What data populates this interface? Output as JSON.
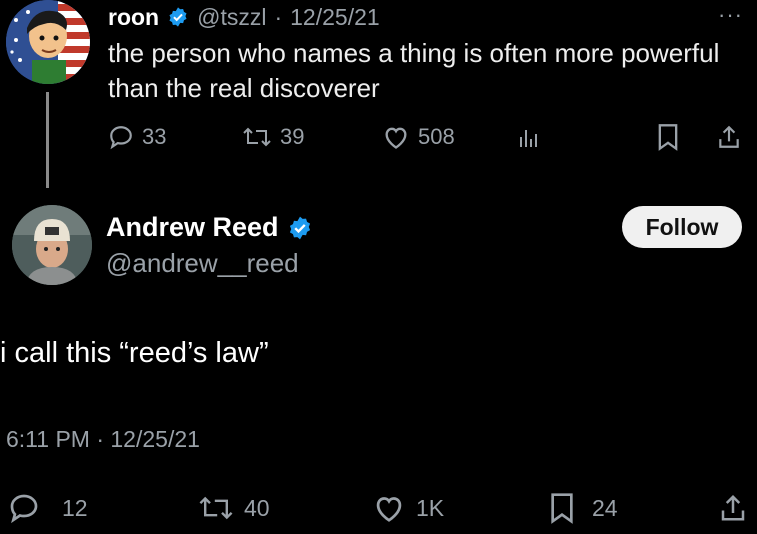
{
  "tweet1": {
    "author_name": "roon",
    "handle": "@tszzl",
    "separator": "·",
    "date": "12/25/21",
    "more_label": "···",
    "text": "the person who names a thing is often more powerful than the real discoverer",
    "replies": "33",
    "retweets": "39",
    "likes": "508"
  },
  "tweet2": {
    "author_name": "Andrew Reed",
    "handle": "@andrew__reed",
    "follow_label": "Follow",
    "text": "i call this “reed’s law”",
    "timestamp": "6:11 PM · 12/25/21",
    "replies": "12",
    "retweets": "40",
    "likes": "1K",
    "bookmarks": "24"
  },
  "colors": {
    "background": "#000000",
    "verified": "#1d9bf0",
    "muted": "#9aa1a8",
    "follow_bg": "#f0f0f0"
  }
}
